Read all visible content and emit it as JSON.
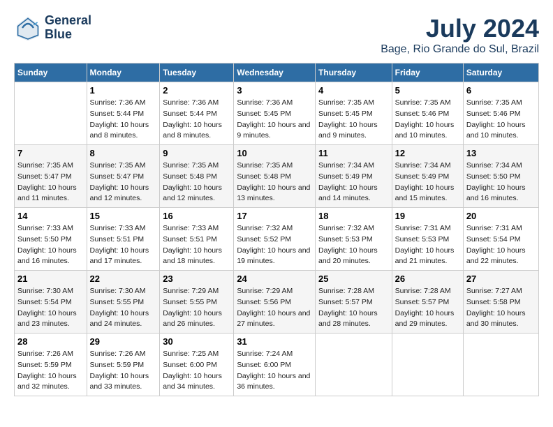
{
  "header": {
    "logo_line1": "General",
    "logo_line2": "Blue",
    "title": "July 2024",
    "subtitle": "Bage, Rio Grande do Sul, Brazil"
  },
  "days_of_week": [
    "Sunday",
    "Monday",
    "Tuesday",
    "Wednesday",
    "Thursday",
    "Friday",
    "Saturday"
  ],
  "weeks": [
    [
      {
        "day": "",
        "sunrise": "",
        "sunset": "",
        "daylight": ""
      },
      {
        "day": "1",
        "sunrise": "Sunrise: 7:36 AM",
        "sunset": "Sunset: 5:44 PM",
        "daylight": "Daylight: 10 hours and 8 minutes."
      },
      {
        "day": "2",
        "sunrise": "Sunrise: 7:36 AM",
        "sunset": "Sunset: 5:44 PM",
        "daylight": "Daylight: 10 hours and 8 minutes."
      },
      {
        "day": "3",
        "sunrise": "Sunrise: 7:36 AM",
        "sunset": "Sunset: 5:45 PM",
        "daylight": "Daylight: 10 hours and 9 minutes."
      },
      {
        "day": "4",
        "sunrise": "Sunrise: 7:35 AM",
        "sunset": "Sunset: 5:45 PM",
        "daylight": "Daylight: 10 hours and 9 minutes."
      },
      {
        "day": "5",
        "sunrise": "Sunrise: 7:35 AM",
        "sunset": "Sunset: 5:46 PM",
        "daylight": "Daylight: 10 hours and 10 minutes."
      },
      {
        "day": "6",
        "sunrise": "Sunrise: 7:35 AM",
        "sunset": "Sunset: 5:46 PM",
        "daylight": "Daylight: 10 hours and 10 minutes."
      }
    ],
    [
      {
        "day": "7",
        "sunrise": "Sunrise: 7:35 AM",
        "sunset": "Sunset: 5:47 PM",
        "daylight": "Daylight: 10 hours and 11 minutes."
      },
      {
        "day": "8",
        "sunrise": "Sunrise: 7:35 AM",
        "sunset": "Sunset: 5:47 PM",
        "daylight": "Daylight: 10 hours and 12 minutes."
      },
      {
        "day": "9",
        "sunrise": "Sunrise: 7:35 AM",
        "sunset": "Sunset: 5:48 PM",
        "daylight": "Daylight: 10 hours and 12 minutes."
      },
      {
        "day": "10",
        "sunrise": "Sunrise: 7:35 AM",
        "sunset": "Sunset: 5:48 PM",
        "daylight": "Daylight: 10 hours and 13 minutes."
      },
      {
        "day": "11",
        "sunrise": "Sunrise: 7:34 AM",
        "sunset": "Sunset: 5:49 PM",
        "daylight": "Daylight: 10 hours and 14 minutes."
      },
      {
        "day": "12",
        "sunrise": "Sunrise: 7:34 AM",
        "sunset": "Sunset: 5:49 PM",
        "daylight": "Daylight: 10 hours and 15 minutes."
      },
      {
        "day": "13",
        "sunrise": "Sunrise: 7:34 AM",
        "sunset": "Sunset: 5:50 PM",
        "daylight": "Daylight: 10 hours and 16 minutes."
      }
    ],
    [
      {
        "day": "14",
        "sunrise": "Sunrise: 7:33 AM",
        "sunset": "Sunset: 5:50 PM",
        "daylight": "Daylight: 10 hours and 16 minutes."
      },
      {
        "day": "15",
        "sunrise": "Sunrise: 7:33 AM",
        "sunset": "Sunset: 5:51 PM",
        "daylight": "Daylight: 10 hours and 17 minutes."
      },
      {
        "day": "16",
        "sunrise": "Sunrise: 7:33 AM",
        "sunset": "Sunset: 5:51 PM",
        "daylight": "Daylight: 10 hours and 18 minutes."
      },
      {
        "day": "17",
        "sunrise": "Sunrise: 7:32 AM",
        "sunset": "Sunset: 5:52 PM",
        "daylight": "Daylight: 10 hours and 19 minutes."
      },
      {
        "day": "18",
        "sunrise": "Sunrise: 7:32 AM",
        "sunset": "Sunset: 5:53 PM",
        "daylight": "Daylight: 10 hours and 20 minutes."
      },
      {
        "day": "19",
        "sunrise": "Sunrise: 7:31 AM",
        "sunset": "Sunset: 5:53 PM",
        "daylight": "Daylight: 10 hours and 21 minutes."
      },
      {
        "day": "20",
        "sunrise": "Sunrise: 7:31 AM",
        "sunset": "Sunset: 5:54 PM",
        "daylight": "Daylight: 10 hours and 22 minutes."
      }
    ],
    [
      {
        "day": "21",
        "sunrise": "Sunrise: 7:30 AM",
        "sunset": "Sunset: 5:54 PM",
        "daylight": "Daylight: 10 hours and 23 minutes."
      },
      {
        "day": "22",
        "sunrise": "Sunrise: 7:30 AM",
        "sunset": "Sunset: 5:55 PM",
        "daylight": "Daylight: 10 hours and 24 minutes."
      },
      {
        "day": "23",
        "sunrise": "Sunrise: 7:29 AM",
        "sunset": "Sunset: 5:55 PM",
        "daylight": "Daylight: 10 hours and 26 minutes."
      },
      {
        "day": "24",
        "sunrise": "Sunrise: 7:29 AM",
        "sunset": "Sunset: 5:56 PM",
        "daylight": "Daylight: 10 hours and 27 minutes."
      },
      {
        "day": "25",
        "sunrise": "Sunrise: 7:28 AM",
        "sunset": "Sunset: 5:57 PM",
        "daylight": "Daylight: 10 hours and 28 minutes."
      },
      {
        "day": "26",
        "sunrise": "Sunrise: 7:28 AM",
        "sunset": "Sunset: 5:57 PM",
        "daylight": "Daylight: 10 hours and 29 minutes."
      },
      {
        "day": "27",
        "sunrise": "Sunrise: 7:27 AM",
        "sunset": "Sunset: 5:58 PM",
        "daylight": "Daylight: 10 hours and 30 minutes."
      }
    ],
    [
      {
        "day": "28",
        "sunrise": "Sunrise: 7:26 AM",
        "sunset": "Sunset: 5:59 PM",
        "daylight": "Daylight: 10 hours and 32 minutes."
      },
      {
        "day": "29",
        "sunrise": "Sunrise: 7:26 AM",
        "sunset": "Sunset: 5:59 PM",
        "daylight": "Daylight: 10 hours and 33 minutes."
      },
      {
        "day": "30",
        "sunrise": "Sunrise: 7:25 AM",
        "sunset": "Sunset: 6:00 PM",
        "daylight": "Daylight: 10 hours and 34 minutes."
      },
      {
        "day": "31",
        "sunrise": "Sunrise: 7:24 AM",
        "sunset": "Sunset: 6:00 PM",
        "daylight": "Daylight: 10 hours and 36 minutes."
      },
      {
        "day": "",
        "sunrise": "",
        "sunset": "",
        "daylight": ""
      },
      {
        "day": "",
        "sunrise": "",
        "sunset": "",
        "daylight": ""
      },
      {
        "day": "",
        "sunrise": "",
        "sunset": "",
        "daylight": ""
      }
    ]
  ]
}
